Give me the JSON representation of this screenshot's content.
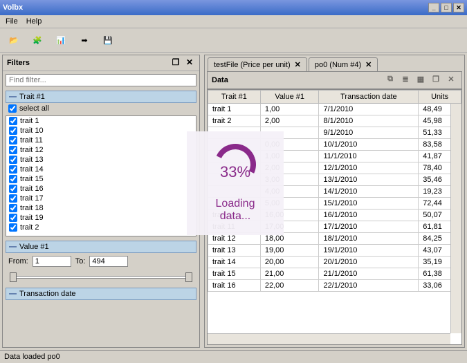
{
  "window": {
    "title": "Volbx"
  },
  "menu": {
    "file": "File",
    "help": "Help"
  },
  "filters": {
    "title": "Filters",
    "find_placeholder": "Find filter...",
    "trait_section": "Trait #1",
    "select_all": "select all",
    "items": [
      "trait 1",
      "trait 10",
      "trait 11",
      "trait 12",
      "trait 13",
      "trait 14",
      "trait 15",
      "trait 16",
      "trait 17",
      "trait 18",
      "trait 19",
      "trait 2"
    ],
    "value_section": "Value #1",
    "from_label": "From:",
    "to_label": "To:",
    "from_value": "1",
    "to_value": "494",
    "txn_section": "Transaction date"
  },
  "tabs": [
    {
      "label": "testFile (Price per unit)"
    },
    {
      "label": "po0 (Num #4)"
    }
  ],
  "data": {
    "title": "Data",
    "columns": [
      "Trait #1",
      "Value #1",
      "Transaction date",
      "Units"
    ],
    "rows": [
      [
        "trait 1",
        "1,00",
        "7/1/2010",
        "48,49"
      ],
      [
        "trait 2",
        "2,00",
        "8/1/2010",
        "45,98"
      ],
      [
        "",
        "",
        "9/1/2010",
        "51,33"
      ],
      [
        "",
        "0,00",
        "10/1/2010",
        "83,58"
      ],
      [
        "",
        "1,00",
        "11/1/2010",
        "41,87"
      ],
      [
        "",
        "2,00",
        "12/1/2010",
        "78,40"
      ],
      [
        "",
        "3,00",
        "13/1/2010",
        "35,46"
      ],
      [
        "",
        "4,00",
        "14/1/2010",
        "19,23"
      ],
      [
        "",
        "5,00",
        "15/1/2010",
        "72,44"
      ],
      [
        "trait 10",
        "16,00",
        "16/1/2010",
        "50,07"
      ],
      [
        "trait 11",
        "17,00",
        "17/1/2010",
        "61,81"
      ],
      [
        "trait 12",
        "18,00",
        "18/1/2010",
        "84,25"
      ],
      [
        "trait 13",
        "19,00",
        "19/1/2010",
        "43,07"
      ],
      [
        "trait 14",
        "20,00",
        "20/1/2010",
        "35,19"
      ],
      [
        "trait 15",
        "21,00",
        "21/1/2010",
        "61,38"
      ],
      [
        "trait 16",
        "22,00",
        "22/1/2010",
        "33,06"
      ]
    ]
  },
  "loading": {
    "percent": "33%",
    "text": "Loading\ndata..."
  },
  "status": "Data loaded po0"
}
